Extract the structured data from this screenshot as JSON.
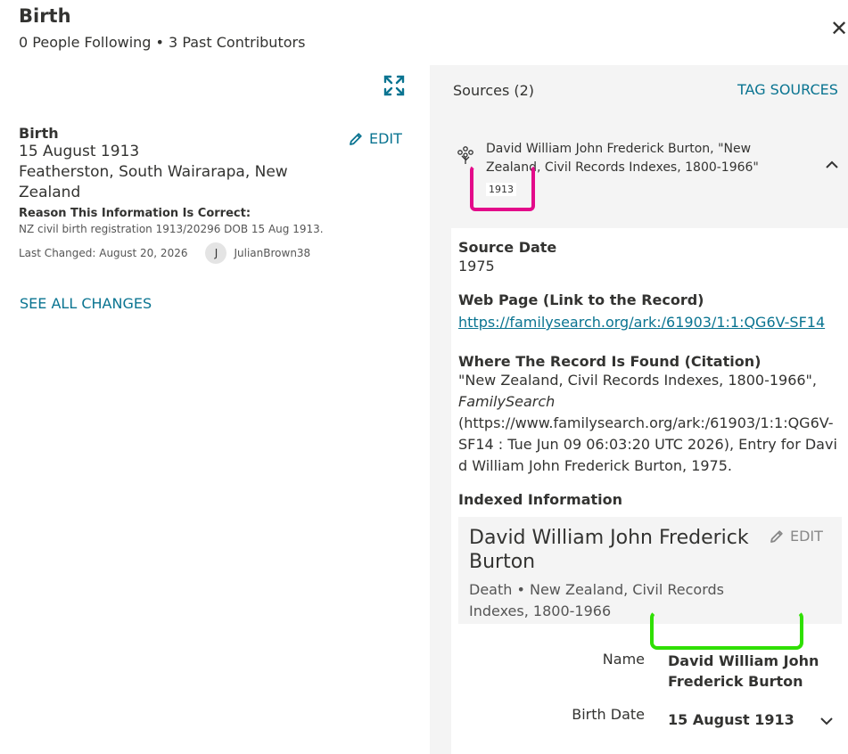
{
  "header": {
    "title": "Birth",
    "subtitle": "0 People Following • 3 Past Contributors",
    "close_icon": "close-icon"
  },
  "fact": {
    "label": "Birth",
    "date": "15 August 1913",
    "place": "Featherston, South Wairarapa, New Zealand",
    "edit_label": "EDIT",
    "reason_label": "Reason This Information Is Correct:",
    "reason_text": "NZ civil birth registration 1913/20296 DOB 15 Aug 1913.",
    "last_changed": "Last Changed: August 20, 2026",
    "contributor_initial": "J",
    "contributor_name": "JulianBrown38",
    "see_all_label": "SEE ALL CHANGES"
  },
  "sources": {
    "title": "Sources (2)",
    "tag_label": "TAG SOURCES",
    "item": {
      "title": "David William John Frederick Burton, \"New Zealand, Civil Records Indexes, 1800-1966\"",
      "year": "1913"
    },
    "detail": {
      "source_date_label": "Source Date",
      "source_date": "1975",
      "web_page_label": "Web Page (Link to the Record)",
      "web_page_url": "https://familysearch.org/ark:/61903/1:1:QG6V-SF14",
      "citation_label": "Where The Record Is Found (Citation)",
      "citation_part1": "\"New Zealand, Civil Records Indexes, 1800-1966\",",
      "citation_italic": "FamilySearch",
      "citation_part2": "(https://www.familysearch.org/ark:/61903/1:1:QG6V-SF14 : Tue Jun 09 06:03:20 UTC 2026), Entry for David William John Frederick Burton, 1975.",
      "indexed_label": "Indexed Information",
      "indexed": {
        "name": "David William John Frederick Burton",
        "edit_label": "EDIT",
        "subtitle": "Death • New Zealand, Civil Records Indexes, 1800-1966"
      },
      "fields": [
        {
          "label": "Name",
          "value": "David William John Frederick Burton"
        },
        {
          "label": "Birth Date",
          "value": "15 August 1913"
        }
      ]
    }
  },
  "colors": {
    "link": "#0a7491",
    "panel_bg": "#f4f4f4",
    "highlight_pink": "#e30a8a",
    "highlight_green": "#2fe000"
  }
}
